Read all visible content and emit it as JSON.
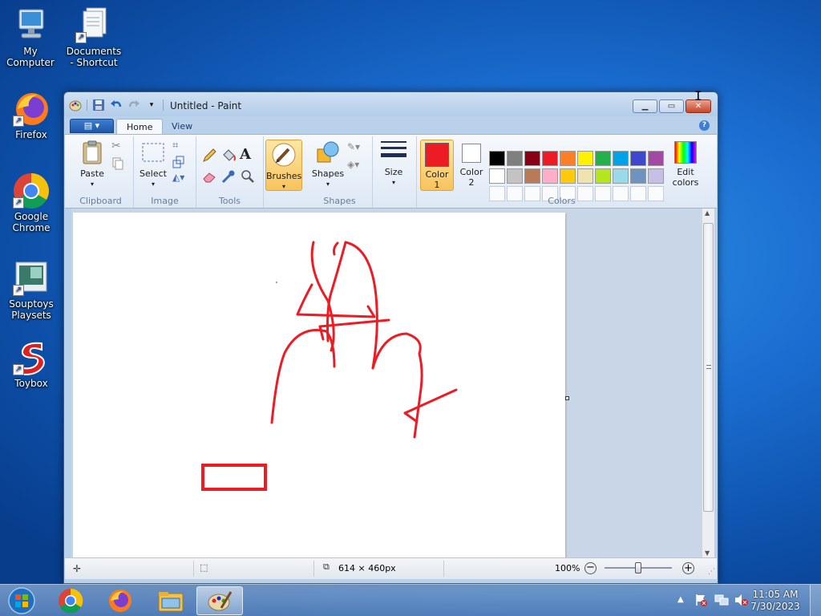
{
  "desktop": {
    "icons": [
      {
        "label": "My Computer",
        "icon": "computer-icon"
      },
      {
        "label": "Documents - Shortcut",
        "icon": "documents-icon"
      },
      {
        "label": "Firefox",
        "icon": "firefox-icon"
      },
      {
        "label": "Google Chrome",
        "icon": "chrome-icon"
      },
      {
        "label": "Souptoys Playsets",
        "icon": "souptoys-icon"
      },
      {
        "label": "Toybox",
        "icon": "toybox-icon"
      }
    ]
  },
  "window": {
    "title": "Untitled - Paint",
    "controls": {
      "minimize": "minimize-icon",
      "maximize": "maximize-icon",
      "close": "close-icon"
    }
  },
  "ribbon": {
    "tabs": [
      "Home",
      "View"
    ],
    "groups": {
      "clipboard": {
        "label": "Clipboard",
        "paste": "Paste"
      },
      "image": {
        "label": "Image",
        "select": "Select"
      },
      "tools": {
        "label": "Tools"
      },
      "brushes": {
        "label": "Brushes"
      },
      "shapes": {
        "label": "Shapes",
        "shapes_btn": "Shapes"
      },
      "size": {
        "label": "Size"
      },
      "colors": {
        "label": "Colors",
        "color1": "Color 1",
        "color2": "Color 2",
        "edit": "Edit colors"
      }
    },
    "color1_value": "#ed1c24",
    "color2_value": "#ffffff",
    "palette_row1": [
      "#000000",
      "#7f7f7f",
      "#880015",
      "#ed1c24",
      "#ff7f27",
      "#fff200",
      "#22b14c",
      "#00a2e8",
      "#3f48cc",
      "#a349a4"
    ],
    "palette_row2": [
      "#ffffff",
      "#c3c3c3",
      "#b97a57",
      "#ffaec9",
      "#ffc90e",
      "#efe4b0",
      "#b5e61d",
      "#99d9ea",
      "#7092be",
      "#c8bfe7"
    ]
  },
  "status": {
    "dimensions": "614 × 460px",
    "zoom": "100%"
  },
  "taskbar": {
    "items": [
      "start-orb-icon",
      "chrome-icon",
      "firefox-icon",
      "explorer-icon",
      "paint-icon"
    ],
    "time": "11:05 AM",
    "date": "7/30/2023"
  }
}
